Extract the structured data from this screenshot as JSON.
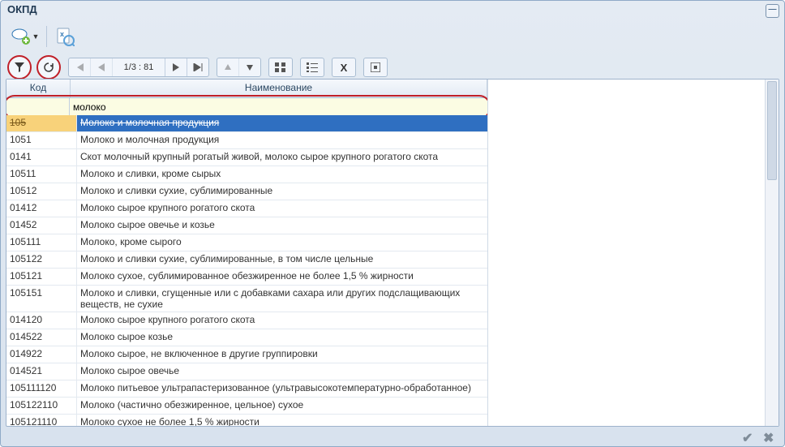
{
  "window": {
    "title": "ОКПД"
  },
  "toolbar1": {
    "new_label": "new-document-icon",
    "export_label": "export-excel-icon"
  },
  "nav": {
    "page_text": "1/3 : 81"
  },
  "grid": {
    "columns": {
      "code": "Код",
      "name": "Наименование"
    },
    "filter": {
      "code": "",
      "name": "молоко"
    },
    "rows": [
      {
        "code": "105",
        "name": "Молоко и молочная продукция",
        "selected": true
      },
      {
        "code": "1051",
        "name": "Молоко и молочная продукция"
      },
      {
        "code": "0141",
        "name": "Скот молочный крупный рогатый живой, молоко сырое крупного рогатого скота"
      },
      {
        "code": "10511",
        "name": "Молоко и сливки, кроме сырых"
      },
      {
        "code": "10512",
        "name": "Молоко и сливки сухие, сублимированные"
      },
      {
        "code": "01412",
        "name": "Молоко сырое крупного рогатого скота"
      },
      {
        "code": "01452",
        "name": "Молоко сырое овечье и козье"
      },
      {
        "code": "105111",
        "name": "Молоко, кроме сырого"
      },
      {
        "code": "105122",
        "name": "Молоко и сливки сухие, сублимированные, в том числе цельные"
      },
      {
        "code": "105121",
        "name": "Молоко сухое, сублимированное обезжиренное не более 1,5 % жирности"
      },
      {
        "code": "105151",
        "name": "Молоко и сливки, сгущенные или с добавками сахара или других подслащивающих веществ, не сухие"
      },
      {
        "code": "014120",
        "name": "Молоко сырое крупного рогатого скота"
      },
      {
        "code": "014522",
        "name": "Молоко сырое козье"
      },
      {
        "code": "014922",
        "name": "Молоко сырое, не включенное в другие группировки"
      },
      {
        "code": "014521",
        "name": "Молоко сырое овечье"
      },
      {
        "code": "105111120",
        "name": "Молоко питьевое ультрапастеризованное (ультравысокотемпературно-обработанное)"
      },
      {
        "code": "105122110",
        "name": "Молоко (частично обезжиренное, цельное) сухое"
      },
      {
        "code": "105121110",
        "name": "Молоко сухое не более 1,5 % жирности"
      }
    ]
  }
}
